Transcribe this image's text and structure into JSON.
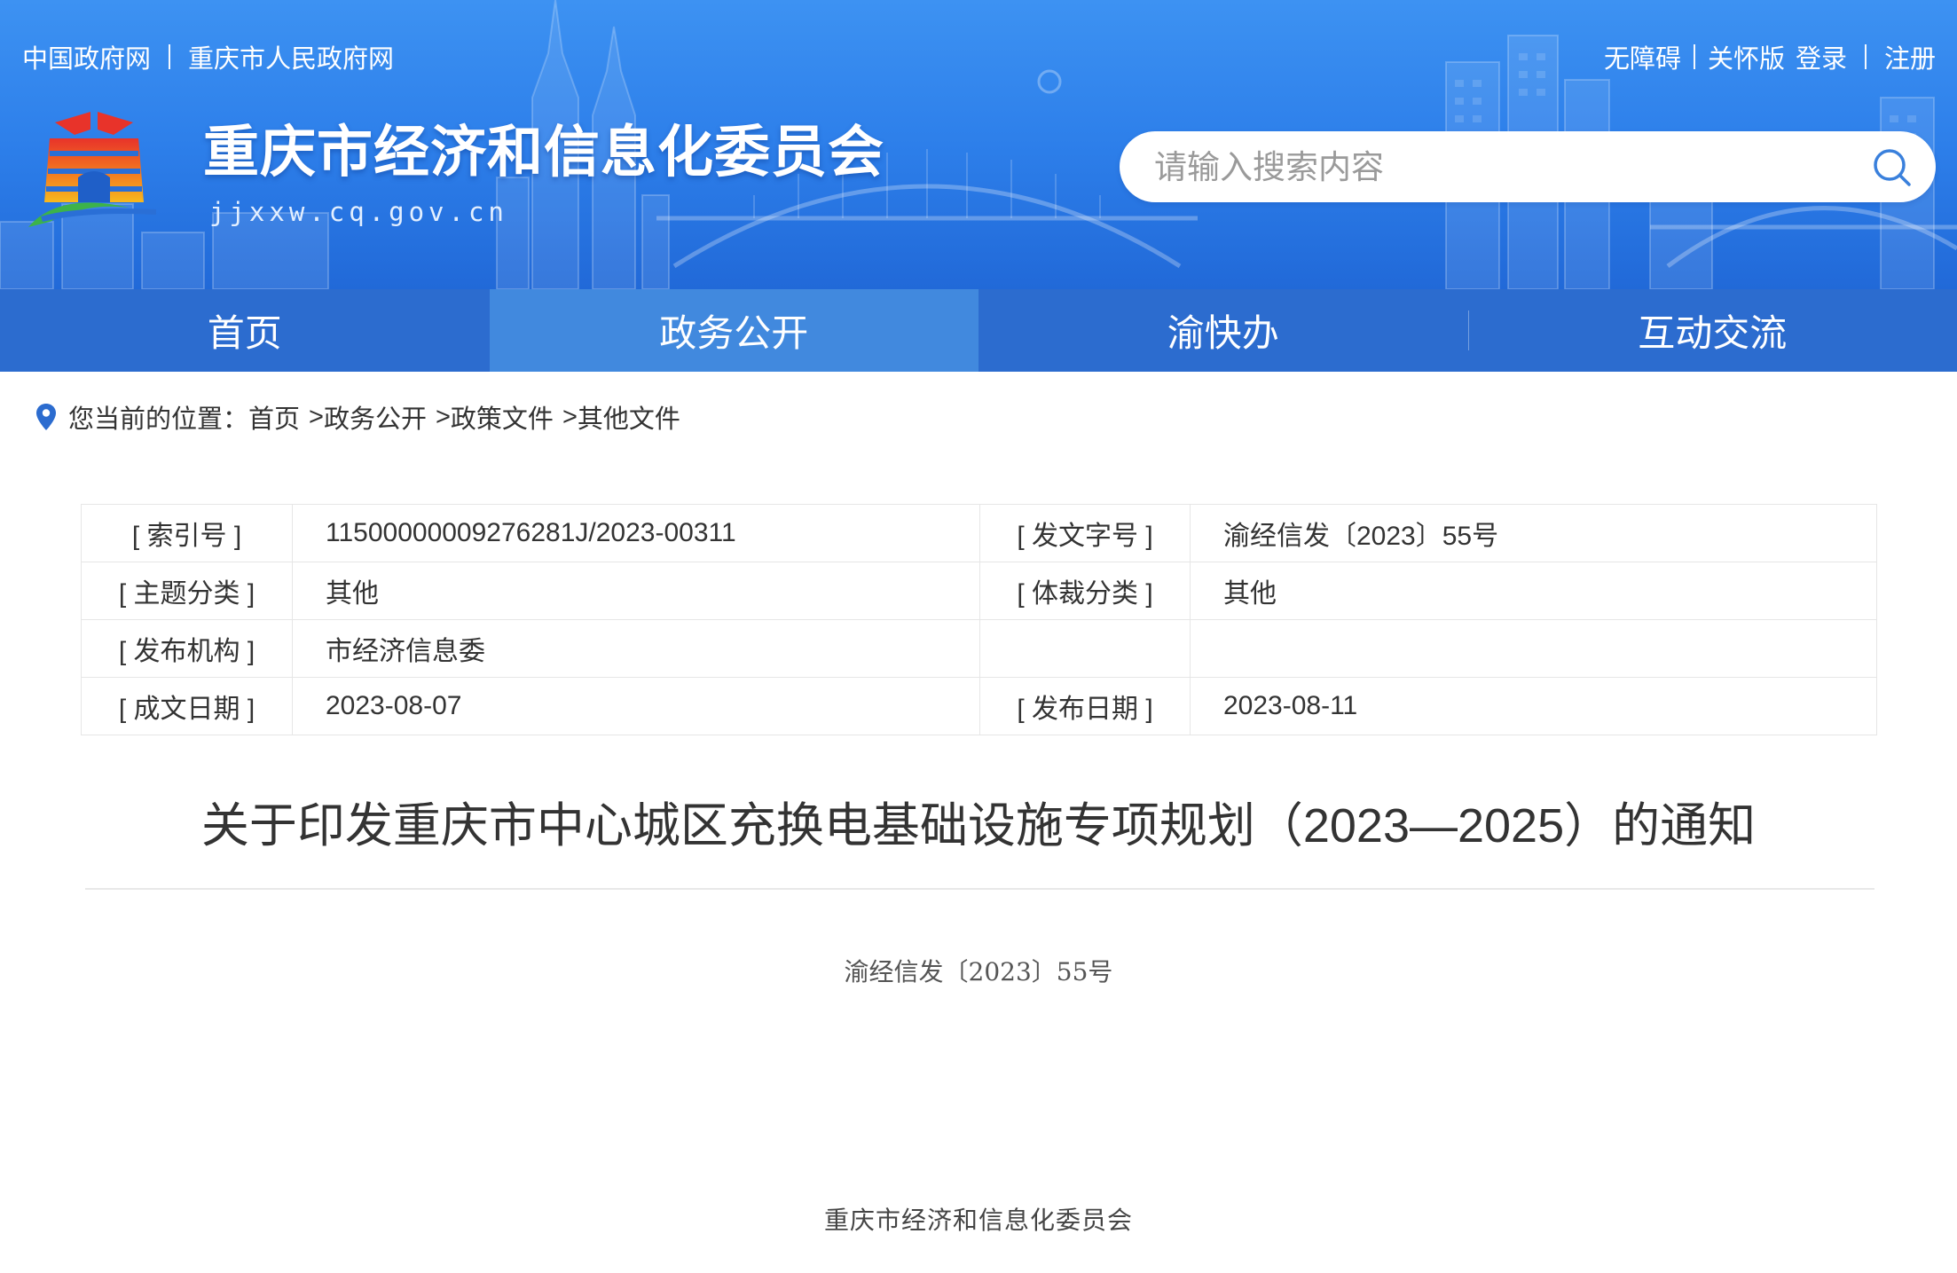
{
  "top_bar": {
    "left_links": [
      "中国政府网",
      "重庆市人民政府网"
    ],
    "right_links": {
      "accessibility": "无障碍",
      "care_mode": "关怀版",
      "login": "登录",
      "register": "注册"
    }
  },
  "site": {
    "title": "重庆市经济和信息化委员会",
    "domain": "jjxxw.cq.gov.cn",
    "logo_icon": "emblem-logo-icon"
  },
  "search": {
    "placeholder": "请输入搜索内容",
    "icon": "search-icon"
  },
  "nav": {
    "items": [
      {
        "label": "首页",
        "active": false
      },
      {
        "label": "政务公开",
        "active": true
      },
      {
        "label": "渝快办",
        "active": false
      },
      {
        "label": "互动交流",
        "active": false
      }
    ]
  },
  "breadcrumb": {
    "icon": "location-pin-icon",
    "prefix": "您当前的位置：",
    "separator": ">",
    "items": [
      "首页",
      "政务公开",
      "政策文件",
      "其他文件"
    ]
  },
  "meta_table": {
    "rows": [
      {
        "label1": "[ 索引号 ]",
        "value1": "11500000009276281J/2023-00311",
        "label2": "[ 发文字号 ]",
        "value2": "渝经信发〔2023〕55号"
      },
      {
        "label1": "[ 主题分类 ]",
        "value1": "其他",
        "label2": "[ 体裁分类 ]",
        "value2": "其他"
      },
      {
        "label1": "[ 发布机构 ]",
        "value1": "市经济信息委",
        "label2": "",
        "value2": ""
      },
      {
        "label1": "[ 成文日期 ]",
        "value1": "2023-08-07",
        "label2": "[ 发布日期 ]",
        "value2": "2023-08-11"
      }
    ]
  },
  "article": {
    "title": "关于印发重庆市中心城区充换电基础设施专项规划（2023—2025）的通知",
    "doc_number": "渝经信发〔2023〕55号",
    "issuer": "重庆市经济和信息化委员会"
  },
  "colors": {
    "header_blue": "#2d7fea",
    "nav_blue": "#2c6ccf",
    "nav_active": "#4189de",
    "text": "#333333",
    "border": "#e6e6e6"
  }
}
